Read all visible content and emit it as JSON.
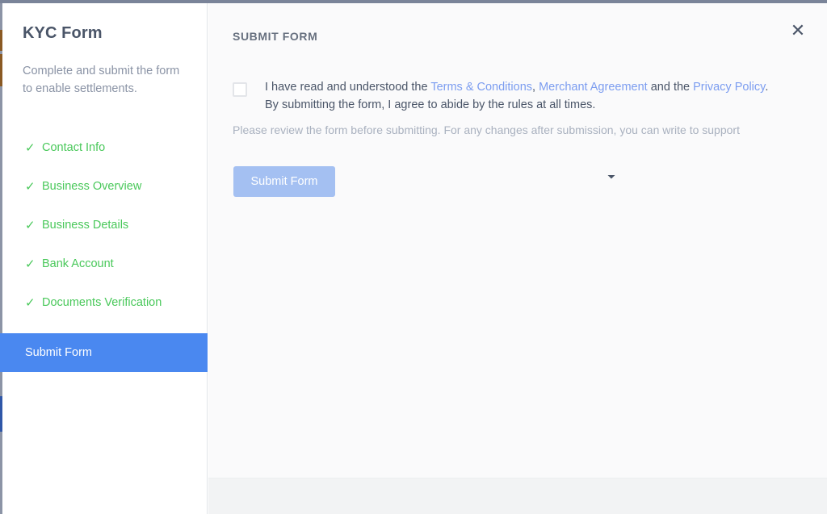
{
  "sidebar": {
    "title": "KYC Form",
    "description": "Complete and submit the form to enable settlements.",
    "tick_glyph": "✓",
    "steps": [
      {
        "label": "Contact Info",
        "state": "complete"
      },
      {
        "label": "Business Overview",
        "state": "complete"
      },
      {
        "label": "Business Details",
        "state": "complete"
      },
      {
        "label": "Bank Account",
        "state": "complete"
      },
      {
        "label": "Documents Verification",
        "state": "complete"
      }
    ],
    "active_step": {
      "label": "Submit Form",
      "state": "active"
    }
  },
  "main": {
    "header": "SUBMIT FORM",
    "close_glyph": "✕",
    "consent": {
      "checked": false,
      "part1": "I have read and understood the ",
      "link1": "Terms & Conditions",
      "sep1": ", ",
      "link2": "Merchant Agreement",
      "sep2": " and the ",
      "link3": "Privacy Policy",
      "part2": ". By submitting the form, I agree to abide by the rules at all times."
    },
    "helper_text": "Please review the form before submitting. For any changes after submission, you can write to support",
    "submit_label": "Submit Form"
  },
  "colors": {
    "active_step_bg": "#4a88f0",
    "complete_step_text": "#49c85a",
    "link": "#7c9df0",
    "submit_button_bg": "#a4c0f2",
    "main_bg": "#fafafb",
    "sidebar_bg": "#ffffff",
    "footer_bg": "#f2f3f4",
    "title_text": "#4a5568",
    "muted_text": "#8a93a5"
  }
}
